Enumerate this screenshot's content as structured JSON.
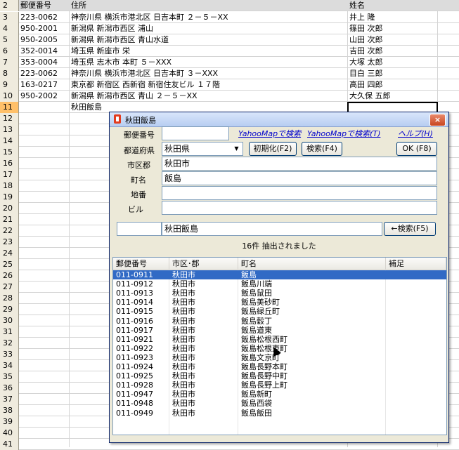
{
  "sheet": {
    "header": {
      "row": "2",
      "postal": "郵便番号",
      "address": "住所",
      "name": "姓名"
    },
    "rows": [
      {
        "n": "3",
        "postal": "223-0062",
        "address": "神奈川県  横浜市港北区  日吉本町  ２－５－XX",
        "name": "井上  隆"
      },
      {
        "n": "4",
        "postal": "950-2001",
        "address": "新潟県  新潟市西区  浦山",
        "name": "篠田  次郎"
      },
      {
        "n": "5",
        "postal": "950-2005",
        "address": "新潟県  新潟市西区  青山水道",
        "name": "山田  次郎"
      },
      {
        "n": "6",
        "postal": "352-0014",
        "address": "埼玉県  新座市  栄",
        "name": "吉田  次郎"
      },
      {
        "n": "7",
        "postal": "353-0004",
        "address": "埼玉県  志木市  本町  ５－XXX",
        "name": "大塚  太郎"
      },
      {
        "n": "8",
        "postal": "223-0062",
        "address": "神奈川県  横浜市港北区  日吉本町  ３－XXX",
        "name": "目白  三郎"
      },
      {
        "n": "9",
        "postal": "163-0217",
        "address": "東京都  新宿区  西新宿    新宿住友ビル １７階",
        "name": "高田  四郎"
      },
      {
        "n": "10",
        "postal": "950-2002",
        "address": "新潟県  新潟市西区  青山  ２－５－XX",
        "name": "大久保  五郎"
      },
      {
        "n": "11",
        "postal": "",
        "address": "秋田飯島",
        "name": ""
      },
      {
        "n": "12",
        "postal": "",
        "address": "",
        "name": ""
      },
      {
        "n": "13",
        "postal": "",
        "address": "",
        "name": ""
      },
      {
        "n": "14",
        "postal": "",
        "address": "",
        "name": ""
      },
      {
        "n": "15",
        "postal": "",
        "address": "",
        "name": ""
      },
      {
        "n": "16",
        "postal": "",
        "address": "",
        "name": ""
      },
      {
        "n": "17",
        "postal": "",
        "address": "",
        "name": ""
      },
      {
        "n": "18",
        "postal": "",
        "address": "",
        "name": ""
      },
      {
        "n": "19",
        "postal": "",
        "address": "",
        "name": ""
      },
      {
        "n": "20",
        "postal": "",
        "address": "",
        "name": ""
      },
      {
        "n": "21",
        "postal": "",
        "address": "",
        "name": ""
      },
      {
        "n": "22",
        "postal": "",
        "address": "",
        "name": ""
      },
      {
        "n": "23",
        "postal": "",
        "address": "",
        "name": ""
      },
      {
        "n": "24",
        "postal": "",
        "address": "",
        "name": ""
      },
      {
        "n": "25",
        "postal": "",
        "address": "",
        "name": ""
      },
      {
        "n": "26",
        "postal": "",
        "address": "",
        "name": ""
      },
      {
        "n": "27",
        "postal": "",
        "address": "",
        "name": ""
      },
      {
        "n": "28",
        "postal": "",
        "address": "",
        "name": ""
      },
      {
        "n": "29",
        "postal": "",
        "address": "",
        "name": ""
      },
      {
        "n": "30",
        "postal": "",
        "address": "",
        "name": ""
      },
      {
        "n": "31",
        "postal": "",
        "address": "",
        "name": ""
      },
      {
        "n": "32",
        "postal": "",
        "address": "",
        "name": ""
      },
      {
        "n": "33",
        "postal": "",
        "address": "",
        "name": ""
      },
      {
        "n": "34",
        "postal": "",
        "address": "",
        "name": ""
      },
      {
        "n": "35",
        "postal": "",
        "address": "",
        "name": ""
      },
      {
        "n": "36",
        "postal": "",
        "address": "",
        "name": ""
      },
      {
        "n": "37",
        "postal": "",
        "address": "",
        "name": ""
      },
      {
        "n": "38",
        "postal": "",
        "address": "",
        "name": ""
      },
      {
        "n": "39",
        "postal": "",
        "address": "",
        "name": ""
      },
      {
        "n": "40",
        "postal": "",
        "address": "",
        "name": ""
      },
      {
        "n": "41",
        "postal": "",
        "address": "",
        "name": ""
      }
    ]
  },
  "dialog": {
    "title": "秋田飯島",
    "close_label": "×",
    "labels": {
      "postal": "郵便番号",
      "prefecture": "都道府県",
      "city": "市区郡",
      "town": "町名",
      "chiban": "地番",
      "building": "ビル"
    },
    "values": {
      "postal": "",
      "prefecture": "秋田県",
      "city": "秋田市",
      "town": "飯島",
      "chiban": "",
      "building": "",
      "search_left": "",
      "search_right": "秋田飯島"
    },
    "links": {
      "yahoo1": "YahooMapで検索",
      "yahoo2": "YahooMapで検索(T)",
      "help": "ヘルプ(H)"
    },
    "buttons": {
      "init": "初期化(F2)",
      "search": "検索(F4)",
      "ok": "OK (F8)",
      "back_search": "←検索(F5)"
    },
    "status": "16件  抽出されました",
    "list": {
      "columns": [
        "郵便番号",
        "市区･郡",
        "町名",
        "補足"
      ],
      "rows": [
        [
          "011-0911",
          "秋田市",
          "飯島",
          ""
        ],
        [
          "011-0912",
          "秋田市",
          "飯島川端",
          ""
        ],
        [
          "011-0913",
          "秋田市",
          "飯島鼠田",
          ""
        ],
        [
          "011-0914",
          "秋田市",
          "飯島美砂町",
          ""
        ],
        [
          "011-0915",
          "秋田市",
          "飯島緑丘町",
          ""
        ],
        [
          "011-0916",
          "秋田市",
          "飯島穀丁",
          ""
        ],
        [
          "011-0917",
          "秋田市",
          "飯島道東",
          ""
        ],
        [
          "011-0921",
          "秋田市",
          "飯島松根西町",
          ""
        ],
        [
          "011-0922",
          "秋田市",
          "飯島松根東町",
          ""
        ],
        [
          "011-0923",
          "秋田市",
          "飯島文京町",
          ""
        ],
        [
          "011-0924",
          "秋田市",
          "飯島長野本町",
          ""
        ],
        [
          "011-0925",
          "秋田市",
          "飯島長野中町",
          ""
        ],
        [
          "011-0928",
          "秋田市",
          "飯島長野上町",
          ""
        ],
        [
          "011-0947",
          "秋田市",
          "飯島新町",
          ""
        ],
        [
          "011-0948",
          "秋田市",
          "飯島西袋",
          ""
        ],
        [
          "011-0949",
          "秋田市",
          "飯島飯田",
          ""
        ]
      ]
    }
  },
  "colors": {
    "selection": "#316ac5",
    "row_header": "#efebde",
    "active_row_header": "#ffc069"
  }
}
